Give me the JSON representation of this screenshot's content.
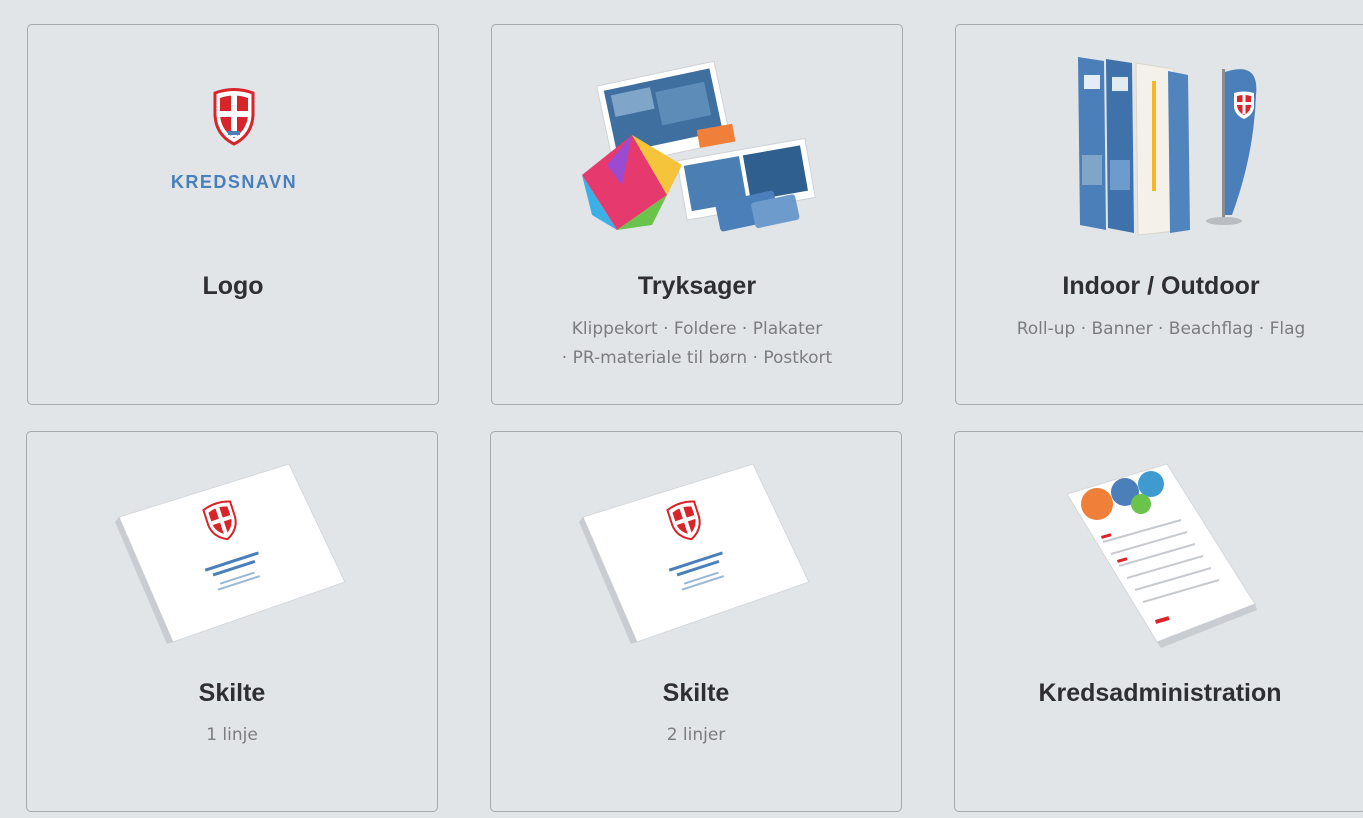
{
  "colors": {
    "background": "#e2e5e8",
    "card_border": "#a5a8ac",
    "title": "#2f2f31",
    "subtitle": "#7a7c80",
    "brand_blue": "#4a7fba",
    "brand_red": "#d8242b"
  },
  "cards": [
    {
      "title": "Logo",
      "subtitle_lines": [],
      "image": "logo-kredsnavn",
      "logo_text": "KREDSNAVN"
    },
    {
      "title": "Tryksager",
      "subtitle_lines": [
        "Klippekort · Foldere · Plakater",
        "· PR-materiale til børn · Postkort"
      ],
      "image": "print-materials-icon"
    },
    {
      "title": "Indoor / Outdoor",
      "subtitle_lines": [
        "Roll-up · Banner · Beachflag · Flag"
      ],
      "image": "rollup-banner-flag-icon"
    },
    {
      "title": "Skilte",
      "subtitle_lines": [
        "1 linje"
      ],
      "image": "sign-one-line-icon"
    },
    {
      "title": "Skilte",
      "subtitle_lines": [
        "2 linjer"
      ],
      "image": "sign-two-lines-icon"
    },
    {
      "title": "Kredsadministration",
      "subtitle_lines": [],
      "image": "admin-form-icon"
    }
  ]
}
